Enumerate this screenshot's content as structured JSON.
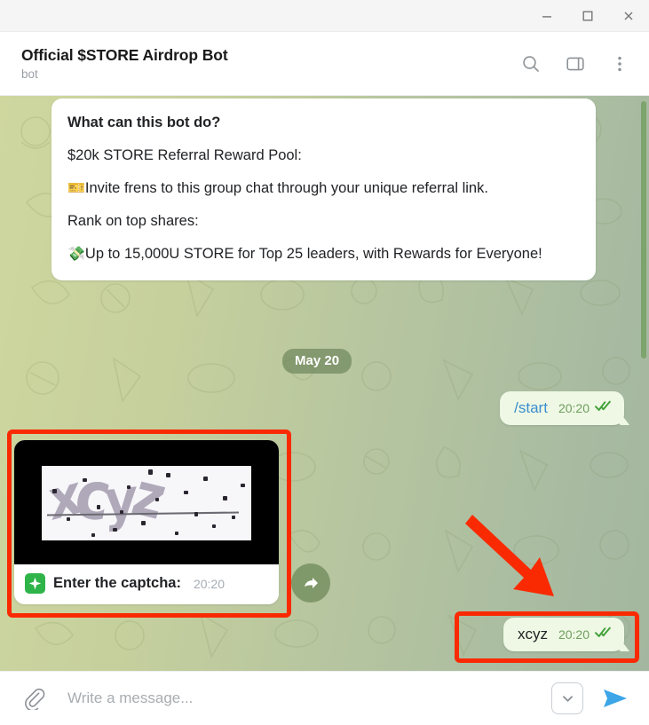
{
  "window": {
    "minimize_label": "Minimize",
    "maximize_label": "Maximize",
    "close_label": "Close"
  },
  "header": {
    "title": "Official $STORE Airdrop Bot",
    "subtitle": "bot",
    "actions": [
      {
        "name": "search-icon",
        "label": "Search"
      },
      {
        "name": "panel-icon",
        "label": "Toggle info panel"
      },
      {
        "name": "more-menu-icon",
        "label": "More options"
      }
    ]
  },
  "messages": {
    "bot_intro": {
      "line1": "What can this bot do?",
      "line2": "$20k STORE Referral Reward Pool:",
      "line3_emoji": "🎫",
      "line3": "Invite frens to this group chat through your unique referral link.",
      "line4": "Rank on top shares:",
      "line5_emoji": "💸",
      "line5": "Up to 15,000U STORE for Top 25 leaders, with Rewards for Everyone!"
    },
    "date_separator": "May 20",
    "start_command": {
      "text": "/start",
      "time": "20:20",
      "ticks": "✓✓"
    },
    "captcha": {
      "code": "xcyz",
      "caption_emoji": "✦",
      "caption": "Enter the captcha:",
      "time": "20:20"
    },
    "reply": {
      "text": "xcyz",
      "time": "20:20",
      "ticks": "✓✓"
    },
    "forward_button_label": "Forward"
  },
  "composer": {
    "attach_label": "Attach file",
    "placeholder": "Write a message...",
    "value": "",
    "scroll_down_label": "Scroll to bottom",
    "send_label": "Send"
  },
  "colors": {
    "accent_send": "#3ca5e8",
    "command_link": "#3b8ed0",
    "tick_green": "#3fa037",
    "annotation_red": "#f92a02",
    "outgoing_bubble": "#eef8e4",
    "badge_green": "#2fb44a"
  }
}
